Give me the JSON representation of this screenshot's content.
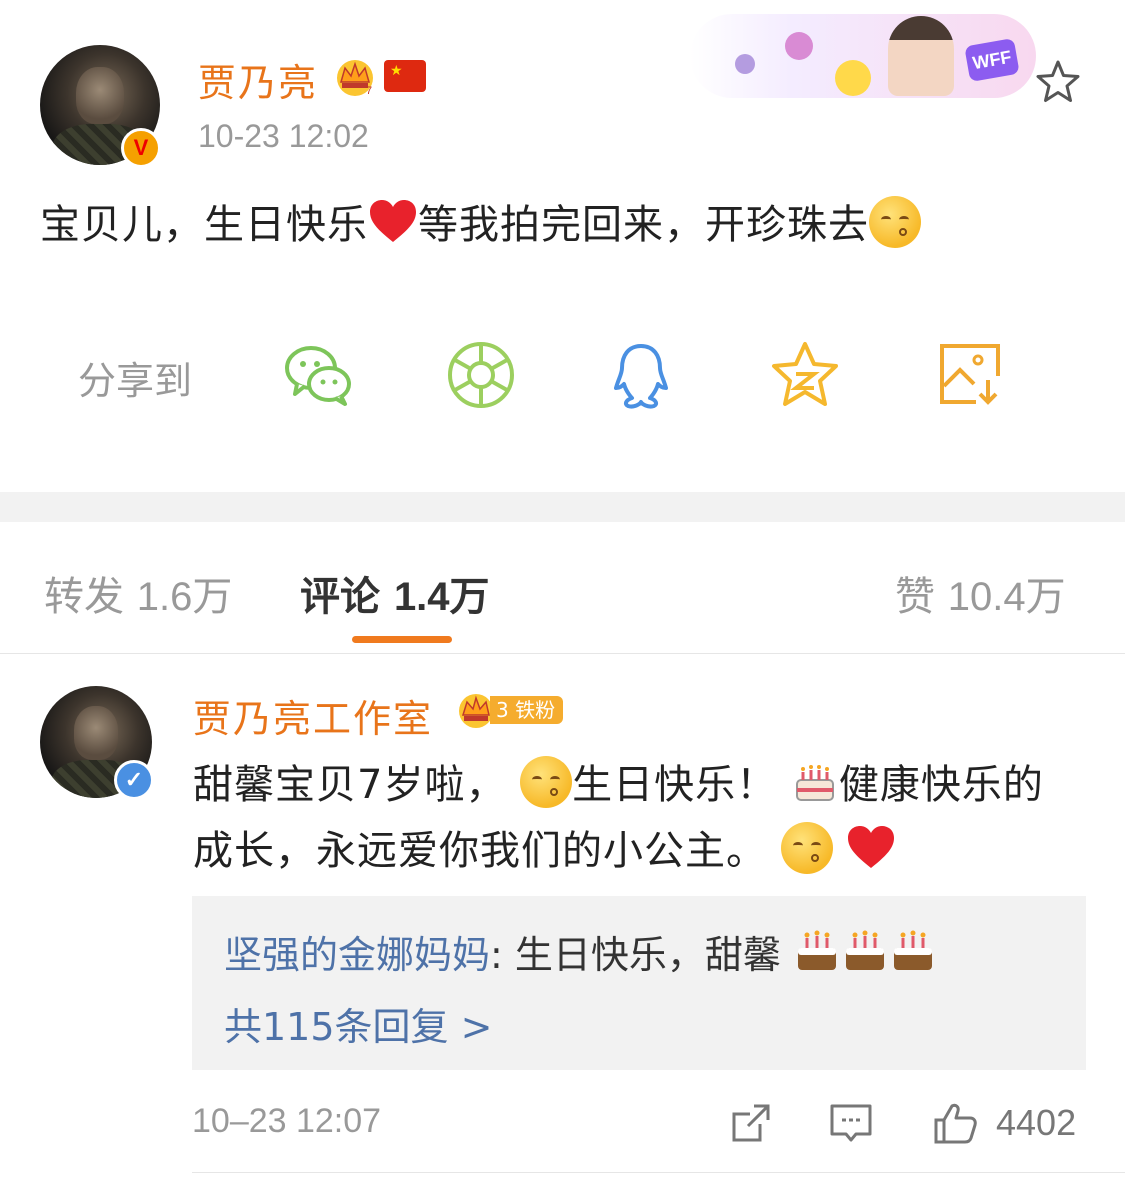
{
  "post": {
    "author": "贾乃亮",
    "timestamp": "10-23 12:02",
    "text_part1": "宝贝儿，生日快乐",
    "text_part2": "等我拍完回来，开珍珠去",
    "share_label": "分享到",
    "banner_text": "WFF",
    "icons": [
      "crown-icon",
      "china-flag-icon",
      "star-favorite-icon",
      "heart-emoji",
      "kiss-face-emoji",
      "wechat-icon",
      "moments-icon",
      "qq-icon",
      "qzone-icon",
      "save-image-icon"
    ]
  },
  "tabs": {
    "repost_label": "转发",
    "repost_count": "1.6万",
    "comment_label": "评论",
    "comment_count": "1.4万",
    "like_label": "赞",
    "like_count": "10.4万"
  },
  "comment": {
    "author": "贾乃亮工作室",
    "badge_level": "3",
    "badge_label": "铁粉",
    "text_part1": "甜馨宝贝7岁啦，",
    "text_part2": "生日快乐！",
    "text_part3": "健康快乐的成长，永远爱你我们的小公主。",
    "reply_user": "坚强的金娜妈妈",
    "reply_text": ": 生日快乐，甜馨",
    "reply_more": "共115条回复 >",
    "timestamp": "10–23 12:07",
    "like_count": "4402"
  },
  "colors": {
    "accent_orange": "#e8741a",
    "tab_indicator": "#f07a1e",
    "link_blue": "#4e72a8",
    "wechat_green": "#7dc55a",
    "qq_blue": "#4a90e2",
    "qzone_yellow": "#f5b82e"
  }
}
